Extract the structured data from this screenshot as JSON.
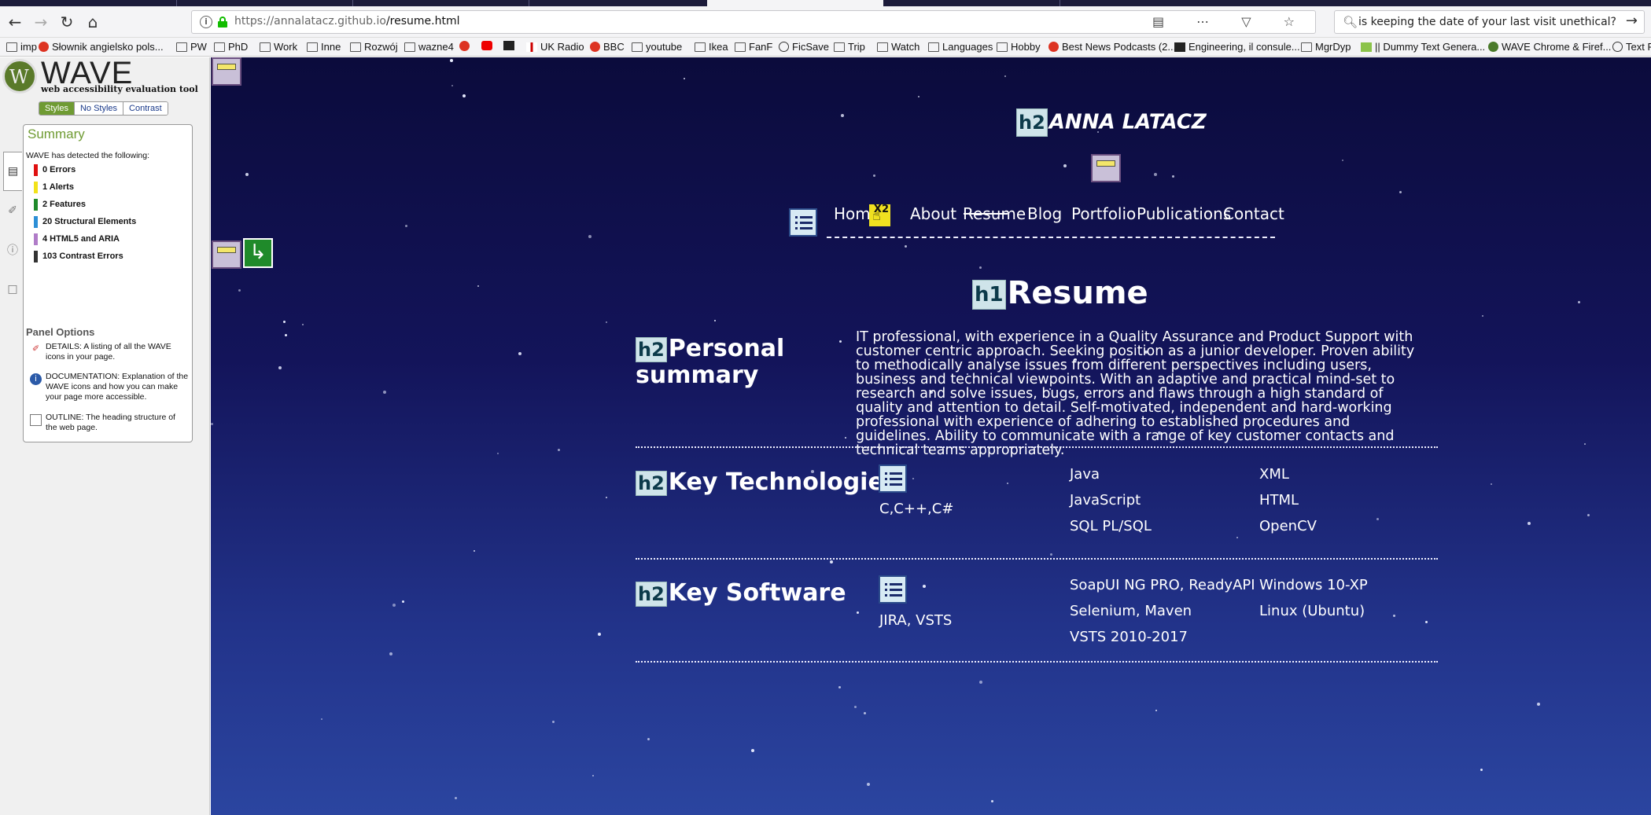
{
  "browser": {
    "url_host": "https://annalatacz.github.io",
    "url_path": "/resume.html",
    "search_text": "is keeping the date of your last visit unethical?",
    "icons": [
      "back-icon",
      "forward-icon",
      "reload-icon",
      "home-icon",
      "reader-icon",
      "more-icon",
      "pocket-icon",
      "bookmark-star-icon",
      "search-icon",
      "go-arrow-icon"
    ]
  },
  "bookmarks": [
    "imp",
    "Słownik angielsko pols...",
    "PW",
    "PhD",
    "Work",
    "Inne",
    "Rozwój",
    "wazne4",
    "",
    "",
    "",
    "UK Radio",
    "BBC",
    "youtube",
    "Ikea",
    "FanF",
    "FicSave",
    "Trip",
    "Watch",
    "Languages",
    "Hobby",
    "Best News Podcasts (2...",
    "Engineering, il consule...",
    "MgrDyp",
    "|| Dummy Text Genera...",
    "WAVE Chrome & Firef...",
    "Text F"
  ],
  "wave": {
    "title": "WAVE",
    "subtitle": "web accessibility evaluation tool",
    "modes": [
      "Styles",
      "No Styles",
      "Contrast"
    ],
    "summary_heading": "Summary",
    "detected_text": "WAVE has detected the following:",
    "counts": [
      {
        "label": "0 Errors",
        "color": "#e01010"
      },
      {
        "label": "1 Alerts",
        "color": "#f2e21a"
      },
      {
        "label": "2 Features",
        "color": "#1f8a2a"
      },
      {
        "label": "20 Structural Elements",
        "color": "#2d8fd6"
      },
      {
        "label": "4 HTML5 and ARIA",
        "color": "#b07cc8"
      },
      {
        "label": "103 Contrast Errors",
        "color": "#333333"
      }
    ],
    "panel_options_heading": "Panel Options",
    "options": [
      "DETAILS: A listing of all the WAVE icons in your page.",
      "DOCUMENTATION: Explanation of the WAVE icons and how you can make your page more accessible.",
      "OUTLINE: The heading structure of the web page."
    ]
  },
  "site": {
    "name": "ANNA LATACZ",
    "nav": [
      "Home",
      "About",
      "Resume",
      "Blog",
      "Portfolio",
      "Publications",
      "Contact"
    ],
    "active_nav": "Resume",
    "x2_label": "X2",
    "page_title": "Resume",
    "badges": {
      "h1": "h1",
      "h2": "h2"
    }
  },
  "sections": {
    "summary": {
      "heading": "Personal summary",
      "text": "IT professional, with experience in a Quality Assurance and Product Support with customer centric approach. Seeking position as a junior developer. Proven ability to methodically analyse issues from different perspectives including users, business and technical viewpoints. With an adaptive and practical mind-set to research and solve issues, bugs, errors and flaws through a high standard of quality and attention to detail. Self-motivated, independent and hard-working professional with experience of adhering to established procedures and guidelines. Ability to communicate with a range of key customer contacts and technical teams appropriately."
    },
    "technologies": {
      "heading": "Key Technologies",
      "items": [
        "C,C++,C#",
        "Java",
        "JavaScript",
        "SQL PL/SQL",
        "XML",
        "HTML",
        "OpenCV"
      ]
    },
    "software": {
      "heading": "Key Software",
      "items": [
        "JIRA, VSTS",
        "SoapUI NG PRO, ReadyAPI",
        "Selenium, Maven",
        "VSTS 2010-2017",
        "Windows 10-XP",
        "Linux (Ubuntu)"
      ]
    }
  }
}
